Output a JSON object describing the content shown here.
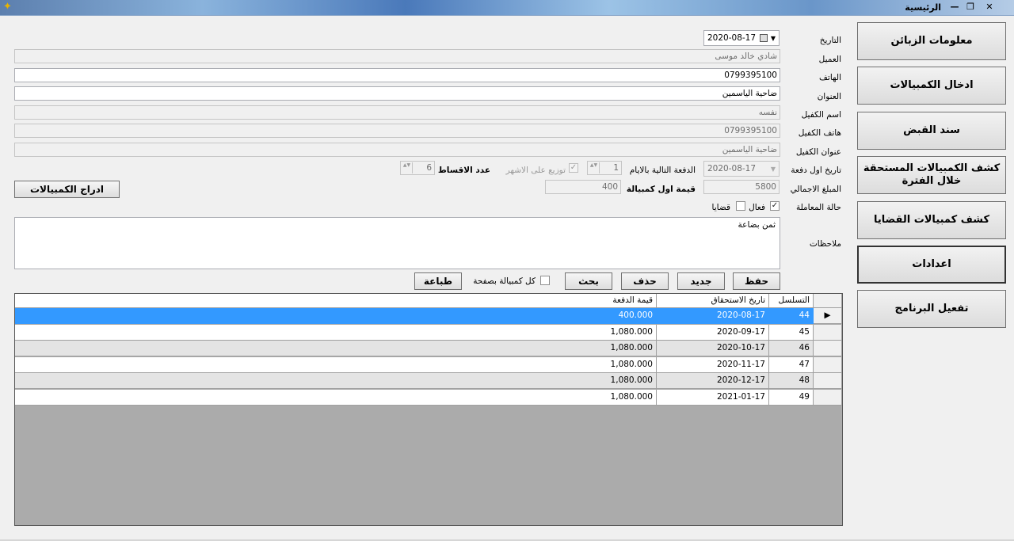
{
  "window": {
    "title": "الرئيسية",
    "minimize": "—",
    "restore": "❐",
    "close": "✕"
  },
  "nav": [
    {
      "label": "معلومات الزبائن"
    },
    {
      "label": "ادخال الكمبيالات"
    },
    {
      "label": "سند القبض"
    },
    {
      "label": "كشف الكمبيالات المستحقة خلال الفترة"
    },
    {
      "label": "كشف كمبيالات القضايا"
    },
    {
      "label": "اعدادات"
    },
    {
      "label": "تفعيل البرنامج"
    }
  ],
  "form": {
    "date_label": "التاريخ",
    "date_value": "2020-08-17",
    "customer_label": "العميل",
    "customer_value": "شادي خالد موسى",
    "phone_label": "الهاتف",
    "phone_value": "0799395100",
    "address_label": "العنوان",
    "address_value": "ضاحية الياسمين",
    "guarantor_name_label": "اسم الكفيل",
    "guarantor_name_value": "نفسه",
    "guarantor_phone_label": "هاتف الكفيل",
    "guarantor_phone_value": "0799395100",
    "guarantor_address_label": "عنوان الكفيل",
    "guarantor_address_value": "ضاحية الياسمين",
    "first_payment_date_label": "تاريخ اول دفعة",
    "first_payment_date_value": "2020-08-17",
    "next_payment_days_label": "الدفعة التالية بالايام",
    "next_payment_days_value": "1",
    "monthly_dist_label": "توزيع على الاشهر",
    "installments_label": "عدد الاقساط",
    "installments_value": "6",
    "total_amount_label": "المبلغ الاجمالي",
    "total_amount_value": "5800",
    "first_bill_label": "قيمة اول كمبيالة",
    "first_bill_value": "400",
    "insert_bills_button": "ادراج الكمبيالات",
    "status_label": "حالة المعاملة",
    "active_label": "فعال",
    "lawsuits_label": "قضايا",
    "notes_label": "ملاحظات",
    "notes_value": "ثمن بضاعة"
  },
  "toolbar": {
    "save": "حفظ",
    "new": "جديد",
    "delete": "حذف",
    "search": "بحث",
    "bill_per_page": "كل كمبيالة بصفحة",
    "print": "طباعة"
  },
  "grid": {
    "headers": {
      "seq": "التسلسل",
      "due_date": "تاريخ الاستحقاق",
      "amount": "قيمة الدفعة"
    },
    "rows": [
      {
        "seq": "44",
        "due_date": "2020-08-17",
        "amount": "400.000",
        "indicator": "▶"
      },
      {
        "seq": "45",
        "due_date": "2020-09-17",
        "amount": "1,080.000",
        "indicator": ""
      },
      {
        "seq": "46",
        "due_date": "2020-10-17",
        "amount": "1,080.000",
        "indicator": ""
      },
      {
        "seq": "47",
        "due_date": "2020-11-17",
        "amount": "1,080.000",
        "indicator": ""
      },
      {
        "seq": "48",
        "due_date": "2020-12-17",
        "amount": "1,080.000",
        "indicator": ""
      },
      {
        "seq": "49",
        "due_date": "2021-01-17",
        "amount": "1,080.000",
        "indicator": ""
      }
    ]
  },
  "icons": {
    "check": "✓",
    "dropdown": "▼",
    "spin": "▲▼",
    "app": "✦"
  }
}
